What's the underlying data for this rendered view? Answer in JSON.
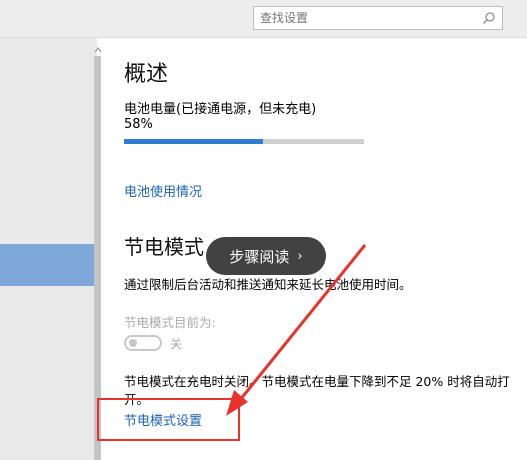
{
  "search": {
    "placeholder": "查找设置"
  },
  "overview": {
    "title": "概述",
    "battery_label": "电池电量(已接通电源，但未充电)",
    "battery_percent": "58%",
    "battery_level": 0.58,
    "usage_link": "电池使用情况"
  },
  "saver": {
    "title": "节电模式",
    "description": "通过限制后台活动和推送通知来延长电池使用时间。",
    "status_label": "节电模式目前为:",
    "toggle_state": "关",
    "note": "节电模式在充电时关闭。节电模式在电量下降到不足 20% 时将自动打开。",
    "settings_link": "节电模式设置"
  },
  "overlay": {
    "popup_label": "步骤阅读",
    "popup_chevron": "›"
  },
  "colors": {
    "accent": "#2d7ed0",
    "link": "#1b62ba",
    "annotation": "#e8322d",
    "nav_selected": "#7ea8da"
  }
}
